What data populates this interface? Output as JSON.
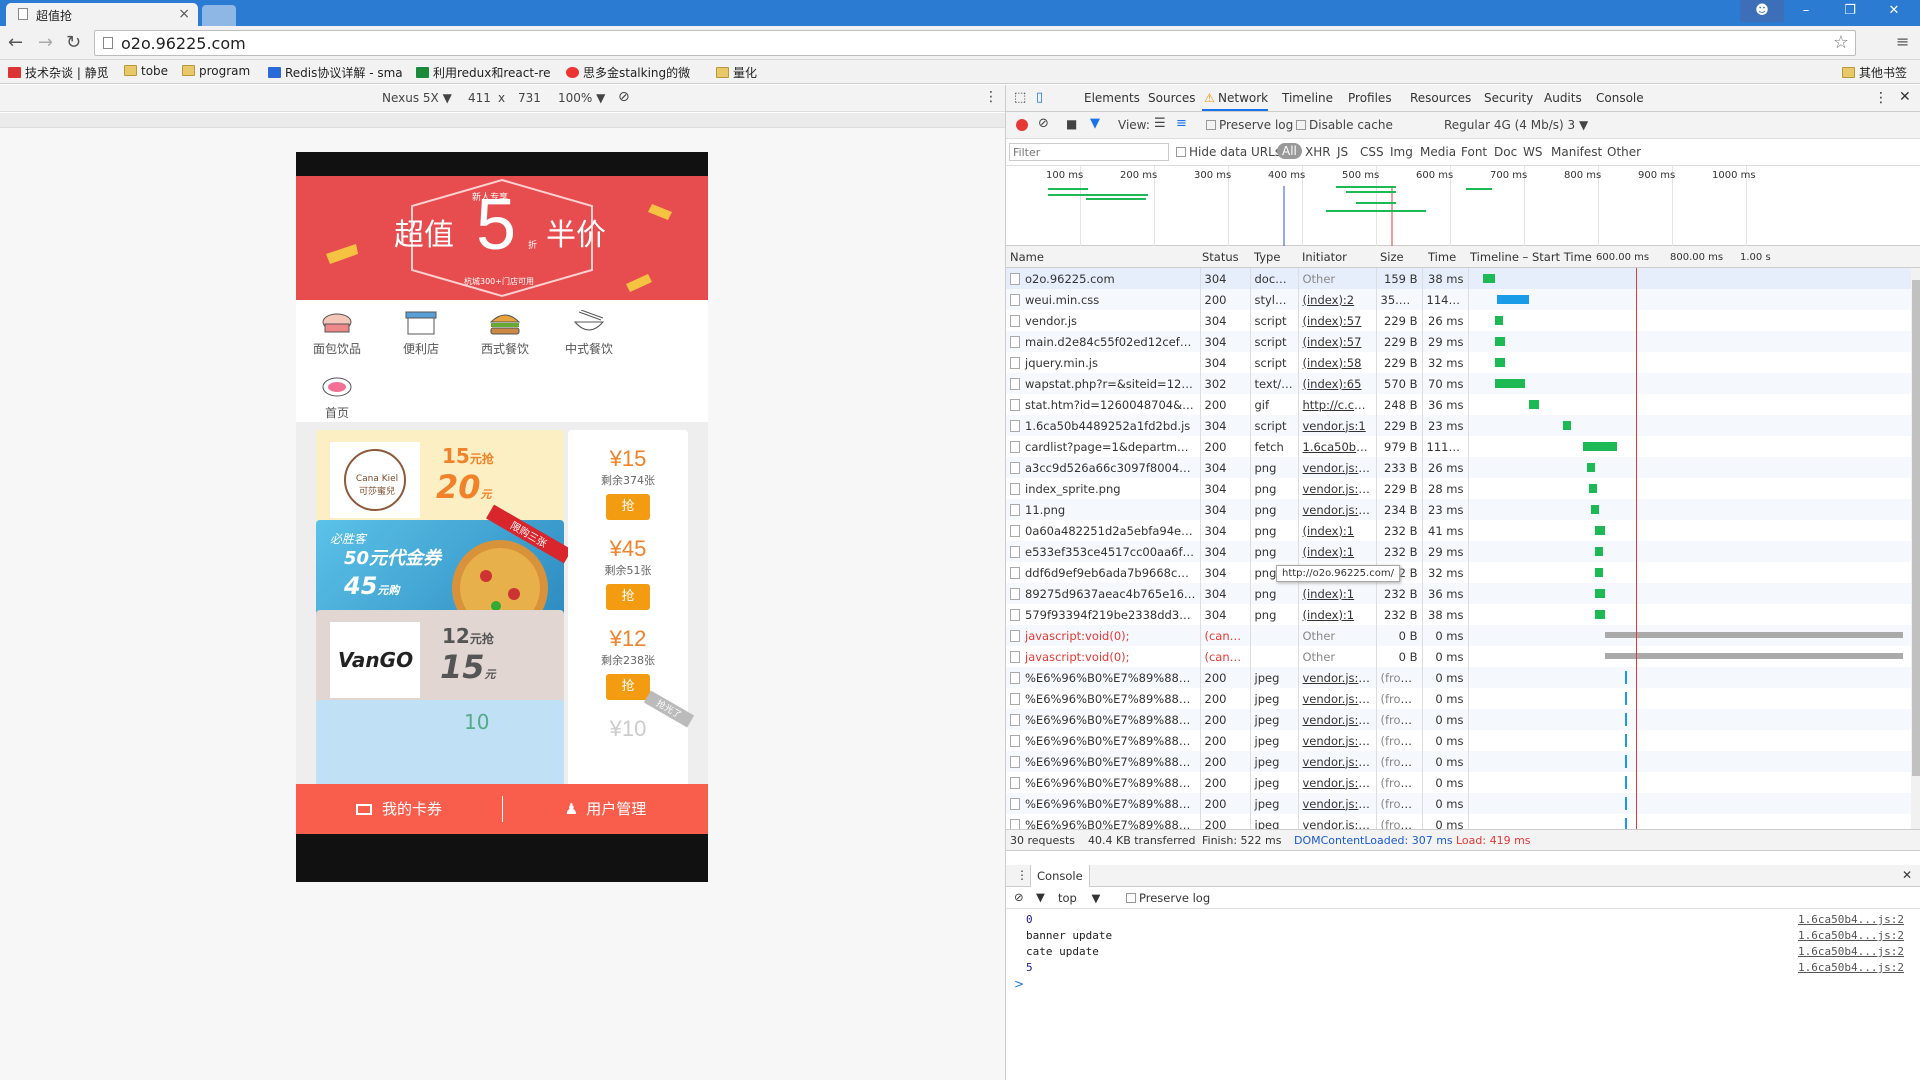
{
  "browser": {
    "tab_title": "超值抢",
    "url": "o2o.96225.com",
    "window_controls": [
      "user",
      "minimize",
      "restore",
      "close"
    ]
  },
  "bookmarks": {
    "items": [
      {
        "label": "技术杂谈 | 静觅",
        "icon": "red-icon"
      },
      {
        "label": "tobe",
        "icon": "folder-icon"
      },
      {
        "label": "program",
        "icon": "folder-icon"
      },
      {
        "label": "Redis协议详解 - sma",
        "icon": "blue-c-icon"
      },
      {
        "label": "利用redux和react-re",
        "icon": "sf-icon"
      },
      {
        "label": "思多金stalking的微",
        "icon": "weibo-icon"
      },
      {
        "label": "量化",
        "icon": "folder-icon"
      }
    ],
    "other": "其他书签"
  },
  "device_toolbar": {
    "device": "Nexus 5X",
    "width": "411",
    "x": "x",
    "height": "731",
    "zoom": "100%"
  },
  "app": {
    "banner": {
      "tag": "新人专享",
      "title_left": "超值",
      "title_num": "5",
      "title_unit": "折",
      "title_right": "半价",
      "subtitle": "杭城300+门店可用",
      "color": "#e74c4e"
    },
    "categories": [
      {
        "label": "面包饮品",
        "icon": "bread-icon"
      },
      {
        "label": "便利店",
        "icon": "store-icon"
      },
      {
        "label": "西式餐饮",
        "icon": "burger-icon"
      },
      {
        "label": "中式餐饮",
        "icon": "noodle-icon"
      },
      {
        "label": "首页",
        "icon": "home-icon"
      }
    ],
    "coupons": [
      {
        "brand": "Cana Kiel 可莎蜜兒",
        "top": "15",
        "top_unit": "元抢",
        "big": "20",
        "big_unit": "元",
        "price": "¥15",
        "remain": "剩余374张",
        "grab": "抢"
      },
      {
        "brand": "必胜客",
        "desc": "50元代金券",
        "big": "45",
        "big_unit": "元购",
        "ribbon": "限购三张",
        "price": "¥45",
        "remain": "剩余51张",
        "grab": "抢"
      },
      {
        "brand": "VanGO",
        "top": "12",
        "top_unit": "元抢",
        "big": "15",
        "big_unit": "元",
        "price": "¥12",
        "remain": "剩余238张",
        "grab": "抢"
      },
      {
        "top": "10",
        "price": "¥10",
        "ribbon": "抢光了"
      }
    ],
    "bottom_nav": [
      {
        "label": "我的卡券",
        "icon": "card-icon"
      },
      {
        "label": "用户管理",
        "icon": "user-icon"
      }
    ],
    "accent": "#f95e4c"
  },
  "devtools": {
    "tabs": [
      "Elements",
      "Sources",
      "Network",
      "Timeline",
      "Profiles",
      "Resources",
      "Security",
      "Audits",
      "Console"
    ],
    "active_tab": "Network",
    "toolbar": {
      "view": "View:",
      "preserve_log": "Preserve log",
      "disable_cache": "Disable cache",
      "throttle": "Regular 4G (4 Mb/s) 3"
    },
    "filter": {
      "placeholder": "Filter",
      "hide_data_urls": "Hide data URLs",
      "types": [
        "All",
        "XHR",
        "JS",
        "CSS",
        "Img",
        "Media",
        "Font",
        "Doc",
        "WS",
        "Manifest",
        "Other"
      ]
    },
    "overview_ticks": [
      "100 ms",
      "200 ms",
      "300 ms",
      "400 ms",
      "500 ms",
      "600 ms",
      "700 ms",
      "800 ms",
      "900 ms",
      "1000 ms"
    ],
    "columns": [
      "Name",
      "Status",
      "Type",
      "Initiator",
      "Size",
      "Time",
      "Timeline – Start Time"
    ],
    "timeline_ticks": [
      "600.00 ms",
      "800.00 ms",
      "1.00 s"
    ],
    "requests": [
      {
        "name": "o2o.96225.com",
        "status": "304",
        "type": "docume...",
        "initiator": "Other",
        "size": "159 B",
        "time": "38 ms"
      },
      {
        "name": "weui.min.css",
        "status": "200",
        "type": "styleshe...",
        "initiator": "(index):2",
        "size": "35.0 KB",
        "time": "114 ms"
      },
      {
        "name": "vendor.js",
        "status": "304",
        "type": "script",
        "initiator": "(index):57",
        "size": "229 B",
        "time": "26 ms"
      },
      {
        "name": "main.d2e84c55f02ed12cefe5.js",
        "status": "304",
        "type": "script",
        "initiator": "(index):57",
        "size": "229 B",
        "time": "29 ms"
      },
      {
        "name": "jquery.min.js",
        "status": "304",
        "type": "script",
        "initiator": "(index):58",
        "size": "229 B",
        "time": "32 ms"
      },
      {
        "name": "wapstat.php?r=&siteid=1260...",
        "status": "302",
        "type": "text/html",
        "initiator": "(index):65",
        "size": "570 B",
        "time": "70 ms"
      },
      {
        "name": "stat.htm?id=1260048704&r=...",
        "status": "200",
        "type": "gif",
        "initiator": "http://c.cnzz.co...",
        "size": "248 B",
        "time": "36 ms"
      },
      {
        "name": "1.6ca50b4489252a1fd2bd.js",
        "status": "304",
        "type": "script",
        "initiator": "vendor.js:1",
        "size": "229 B",
        "time": "23 ms"
      },
      {
        "name": "cardlist?page=1&department...",
        "status": "200",
        "type": "fetch",
        "initiator": "1.6ca50b4...js:1",
        "size": "979 B",
        "time": "111 ms"
      },
      {
        "name": "a3cc9d526a66c3097f8004129...",
        "status": "304",
        "type": "png",
        "initiator": "vendor.js:23",
        "size": "233 B",
        "time": "26 ms"
      },
      {
        "name": "index_sprite.png",
        "status": "304",
        "type": "png",
        "initiator": "vendor.js:23",
        "size": "229 B",
        "time": "28 ms"
      },
      {
        "name": "11.png",
        "status": "304",
        "type": "png",
        "initiator": "vendor.js:24",
        "size": "234 B",
        "time": "23 ms"
      },
      {
        "name": "0a60a482251d2a5ebfa94e776...",
        "status": "304",
        "type": "png",
        "initiator": "(index):1",
        "size": "232 B",
        "time": "41 ms"
      },
      {
        "name": "e533ef353ce4517cc00aa6fda...",
        "status": "304",
        "type": "png",
        "initiator": "(index):1",
        "size": "232 B",
        "time": "29 ms"
      },
      {
        "name": "ddf6d9ef9eb6ada7b9668c60a...",
        "status": "304",
        "type": "png",
        "initiator": "(index):1",
        "size": "232 B",
        "time": "32 ms"
      },
      {
        "name": "89275d9637aeac4b765e16f04...",
        "status": "304",
        "type": "png",
        "initiator": "(index):1",
        "size": "232 B",
        "time": "36 ms"
      },
      {
        "name": "579f93394f219be2338dd3c45...",
        "status": "304",
        "type": "png",
        "initiator": "(index):1",
        "size": "232 B",
        "time": "38 ms"
      },
      {
        "name": "javascript:void(0);",
        "status": "(cancel...",
        "type": "",
        "initiator": "Other",
        "size": "0 B",
        "time": "0 ms"
      },
      {
        "name": "javascript:void(0);",
        "status": "(cancel...",
        "type": "",
        "initiator": "Other",
        "size": "0 B",
        "time": "0 ms"
      },
      {
        "name": "%E6%96%B0%E7%89%88%E...",
        "status": "200",
        "type": "jpeg",
        "initiator": "vendor.js:24",
        "size": "(from c...",
        "time": "0 ms"
      },
      {
        "name": "%E6%96%B0%E7%89%88%E...",
        "status": "200",
        "type": "jpeg",
        "initiator": "vendor.js:24",
        "size": "(from c...",
        "time": "0 ms"
      },
      {
        "name": "%E6%96%B0%E7%89%88%E...",
        "status": "200",
        "type": "jpeg",
        "initiator": "vendor.js:24",
        "size": "(from c...",
        "time": "0 ms"
      },
      {
        "name": "%E6%96%B0%E7%89%88%E...",
        "status": "200",
        "type": "jpeg",
        "initiator": "vendor.js:24",
        "size": "(from c...",
        "time": "0 ms"
      },
      {
        "name": "%E6%96%B0%E7%89%88%E...",
        "status": "200",
        "type": "jpeg",
        "initiator": "vendor.js:24",
        "size": "(from c...",
        "time": "0 ms"
      },
      {
        "name": "%E6%96%B0%E7%89%88%E...",
        "status": "200",
        "type": "jpeg",
        "initiator": "vendor.js:24",
        "size": "(from c...",
        "time": "0 ms"
      },
      {
        "name": "%E6%96%B0%E7%89%88%E...",
        "status": "200",
        "type": "jpeg",
        "initiator": "vendor.js:24",
        "size": "(from c...",
        "time": "0 ms"
      },
      {
        "name": "%E6%96%B0%E7%89%88%E...",
        "status": "200",
        "type": "jpeg",
        "initiator": "vendor.js:24",
        "size": "(from c...",
        "time": "0 ms"
      }
    ],
    "tooltip": "http://o2o.96225.com/",
    "summary": {
      "requests": "30 requests",
      "transferred": "40.4 KB transferred",
      "finish": "Finish: 522 ms",
      "dcl": "DOMContentLoaded: 307 ms",
      "load": "Load: 419 ms"
    },
    "console": {
      "title": "Console",
      "context": "top",
      "preserve_log": "Preserve log",
      "lines": [
        {
          "text": "0",
          "source": "1.6ca50b4...js:2"
        },
        {
          "text": "banner update",
          "source": "1.6ca50b4...js:2"
        },
        {
          "text": "cate update",
          "source": "1.6ca50b4...js:2"
        },
        {
          "text": "5",
          "source": "1.6ca50b4...js:2"
        }
      ],
      "prompt": ">"
    }
  }
}
